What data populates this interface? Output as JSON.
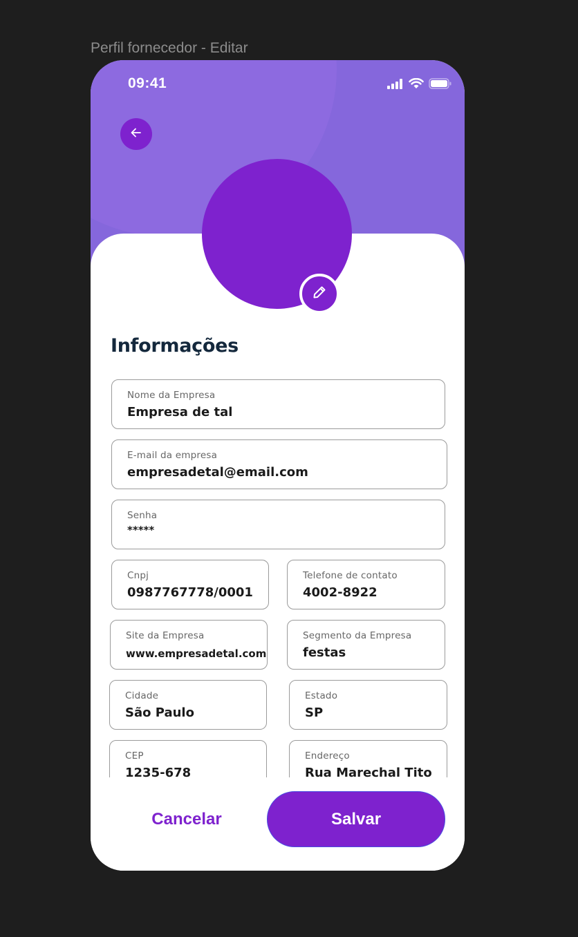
{
  "frame_label": "Perfil fornecedor - Editar",
  "status_bar": {
    "time": "09:41",
    "icons": [
      "signal-icon",
      "wifi-icon",
      "battery-icon"
    ]
  },
  "header": {
    "back_icon": "arrow-left-icon",
    "edit_icon": "pencil-icon"
  },
  "section_title": "Informações",
  "fields": {
    "company_name": {
      "label": "Nome da Empresa",
      "value": "Empresa de tal"
    },
    "email": {
      "label": "E-mail da empresa",
      "value": "empresadetal@email.com"
    },
    "password": {
      "label": "Senha",
      "value": "*****"
    },
    "cnpj": {
      "label": "Cnpj",
      "value": "0987767778/0001"
    },
    "phone": {
      "label": "Telefone de contato",
      "value": "4002-8922"
    },
    "website": {
      "label": "Site da Empresa",
      "value": "www.empresadetal.com"
    },
    "segment": {
      "label": "Segmento da Empresa",
      "value": "festas"
    },
    "city": {
      "label": "Cidade",
      "value": "São Paulo"
    },
    "state": {
      "label": "Estado",
      "value": "SP"
    },
    "cep": {
      "label": "CEP",
      "value": "1235-678"
    },
    "address": {
      "label": "Endereço",
      "value": "Rua Marechal Tito"
    }
  },
  "actions": {
    "cancel_label": "Cancelar",
    "save_label": "Salvar"
  },
  "colors": {
    "primary": "#7e22ce",
    "header": "#8567dc",
    "title": "#14283c",
    "canvas": "#1e1e1e"
  }
}
